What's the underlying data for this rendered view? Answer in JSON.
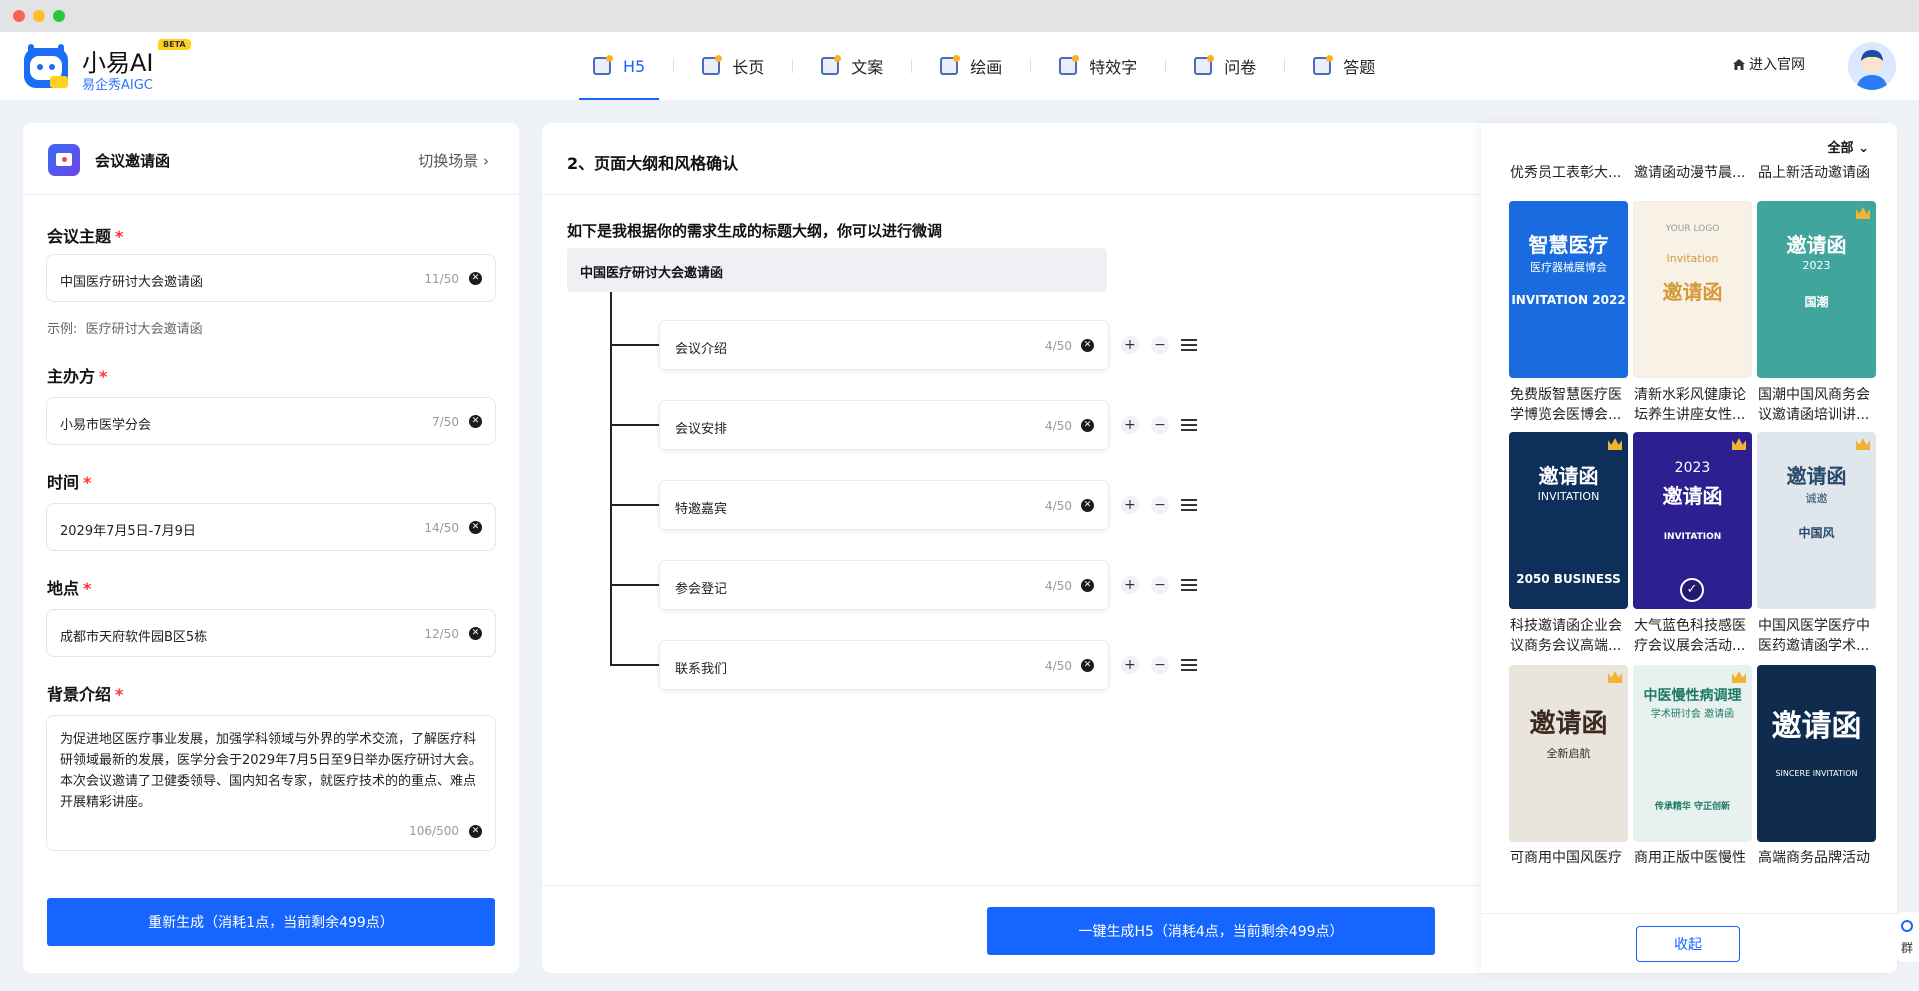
{
  "app": {
    "name": "小易AI",
    "badge": "BETA",
    "subtitle": "易企秀AIGC"
  },
  "nav": {
    "items": [
      {
        "label": "H5",
        "icon": "h5-icon",
        "active": true
      },
      {
        "label": "长页",
        "icon": "long-page-icon"
      },
      {
        "label": "文案",
        "icon": "copywriting-icon"
      },
      {
        "label": "绘画",
        "icon": "painting-icon"
      },
      {
        "label": "特效字",
        "icon": "effect-text-icon"
      },
      {
        "label": "问卷",
        "icon": "survey-icon"
      },
      {
        "label": "答题",
        "icon": "quiz-icon"
      }
    ],
    "site_link": "进入官网"
  },
  "colors": {
    "primary": "#1665ff",
    "required": "#ff3333"
  },
  "left": {
    "scene_title": "会议邀请函",
    "scene_switch": "切换场景",
    "fields": [
      {
        "label": "会议主题",
        "value": "中国医疗研讨大会邀请函",
        "count": "11/50"
      },
      {
        "label": "主办方",
        "value": "小易市医学分会",
        "count": "7/50"
      },
      {
        "label": "时间",
        "value": "2029年7月5日-7月9日",
        "count": "14/50"
      },
      {
        "label": "地点",
        "value": "成都市天府软件园B区5栋",
        "count": "12/50"
      }
    ],
    "example_label": "示例:",
    "example_value": "医疗研讨大会邀请函",
    "background_label": "背景介绍",
    "background_value": "为促进地区医疗事业发展，加强学科领域与外界的学术交流，了解医疗科研领域最新的发展，医学分会于2029年7月5日至9日举办医疗研讨大会。本次会议邀请了卫健委领导、国内知名专家，就医疗技术的的重点、难点开展精彩讲座。",
    "background_count": "106/500",
    "regen_button": "重新生成（消耗1点，当前剩余499点）"
  },
  "middle": {
    "title": "2、页面大纲和风格确认",
    "desc": "如下是我根据你的需求生成的标题大纲，你可以进行微调",
    "root": "中国医疗研讨大会邀请函",
    "nodes": [
      {
        "label": "会议介绍",
        "count": "4/50"
      },
      {
        "label": "会议安排",
        "count": "4/50"
      },
      {
        "label": "特邀嘉宾",
        "count": "4/50"
      },
      {
        "label": "参会登记",
        "count": "4/50"
      },
      {
        "label": "联系我们",
        "count": "4/50"
      }
    ],
    "generate_button": "一键生成H5（消耗4点，当前剩余499点）"
  },
  "right": {
    "filter": "全部",
    "top_captions": [
      "优秀员工表彰大...",
      "邀请函动漫节晨...",
      "品上新活动邀请函"
    ],
    "cards": [
      {
        "title": "智慧医疗",
        "line2": "医疗器械展博会",
        "line3": "INVITATION 2022",
        "bg": "#1a6be0",
        "caption1": "免费版智慧医疗医",
        "caption2": "学博览会医博会..."
      },
      {
        "title": "邀请函",
        "line2": "Invitation",
        "line3": "YOUR LOGO",
        "bg": "#f8f2e6",
        "caption1": "清新水彩风健康论",
        "caption2": "坛养生讲座女性..."
      },
      {
        "title": "邀请函",
        "line2": "2023",
        "line3": "国潮",
        "bg": "#3fa59d",
        "caption1": "国潮中国风商务会",
        "caption2": "议邀请函培训讲..."
      },
      {
        "title": "邀请函",
        "line2": "INVITATION",
        "line3": "2050 BUSINESS",
        "bg": "#0d2f5a",
        "caption1": "科技邀请函企业会",
        "caption2": "议商务会议高端..."
      },
      {
        "title": "邀请函",
        "line2": "2023",
        "line3": "INVITATION",
        "bg": "#2d1f8f",
        "caption1": "大气蓝色科技感医",
        "caption2": "疗会议展会活动..."
      },
      {
        "title": "邀请函",
        "line2": "诚邀",
        "line3": "中国风",
        "bg": "#dfe6ec",
        "caption1": "中国风医学医疗中",
        "caption2": "医药邀请函学术..."
      },
      {
        "title": "邀请函",
        "line2": "全新启航",
        "line3": "",
        "bg": "#e9e4dc",
        "caption1": "可商用中国风医疗",
        "caption2": ""
      },
      {
        "title": "中医慢性病调理",
        "line2": "学术研讨会 邀请函",
        "line3": "传承精华 守正创新",
        "bg": "#e7f1ee",
        "caption1": "商用正版中医慢性",
        "caption2": ""
      },
      {
        "title": "邀请函",
        "line2": "SINCERE INVITATION",
        "line3": "",
        "bg": "#0f2c4f",
        "caption1": "高端商务品牌活动",
        "caption2": ""
      }
    ],
    "collapse_button": "收起"
  },
  "side_tab": {
    "label": "群"
  }
}
